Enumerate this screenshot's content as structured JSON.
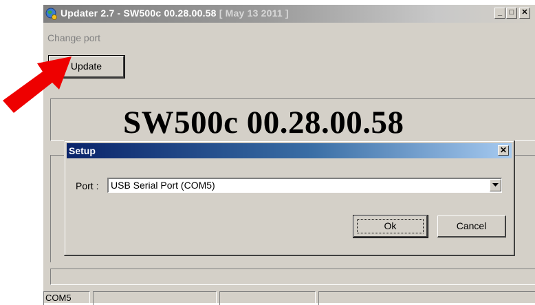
{
  "window": {
    "title": "Updater 2.7 - SW500c 00.28.00.58",
    "title_date": "[ May 13 2011 ]",
    "buttons": {
      "minimize": "_",
      "maximize": "□",
      "close": "✕"
    }
  },
  "menu": {
    "change_port": "Change port"
  },
  "main": {
    "update_label": "Update",
    "version_text": "SW500c 00.28.00.58"
  },
  "status": {
    "port": "COM5"
  },
  "dialog": {
    "title": "Setup",
    "close": "✕",
    "port_label": "Port :",
    "port_value": "USB Serial Port (COM5)",
    "ok_label": "Ok",
    "cancel_label": "Cancel"
  },
  "colors": {
    "annotation_arrow": "#ee0000",
    "dialog_title_start": "#0a246a",
    "dialog_title_end": "#a6caf0",
    "window_face": "#d4d0c8"
  }
}
